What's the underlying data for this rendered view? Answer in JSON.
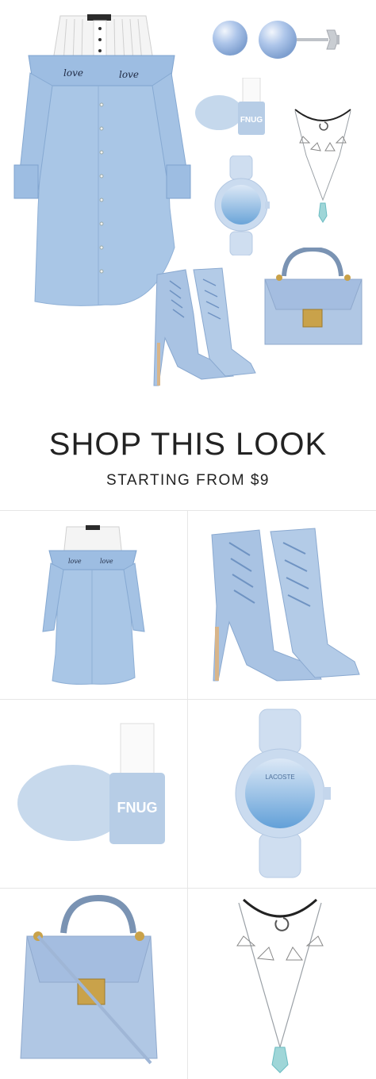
{
  "shop": {
    "title": "SHOP THIS LOOK",
    "subtitle": "STARTING FROM $9"
  },
  "products": [
    {
      "name": "shirt-dress",
      "embroidery_left": "love",
      "embroidery_right": "love"
    },
    {
      "name": "lace-up-denim-booties"
    },
    {
      "name": "nail-polish",
      "brand": "FNUG"
    },
    {
      "name": "watch",
      "brand": "LACOSTE"
    },
    {
      "name": "top-handle-bag"
    },
    {
      "name": "choker-necklace"
    }
  ],
  "colors": {
    "denim": "#a9c6e6",
    "denim_dark": "#7ea3cf",
    "pale_blue": "#c9d9ec",
    "gold": "#c9a24a",
    "text": "#222222",
    "divider": "#e6e6e6"
  }
}
